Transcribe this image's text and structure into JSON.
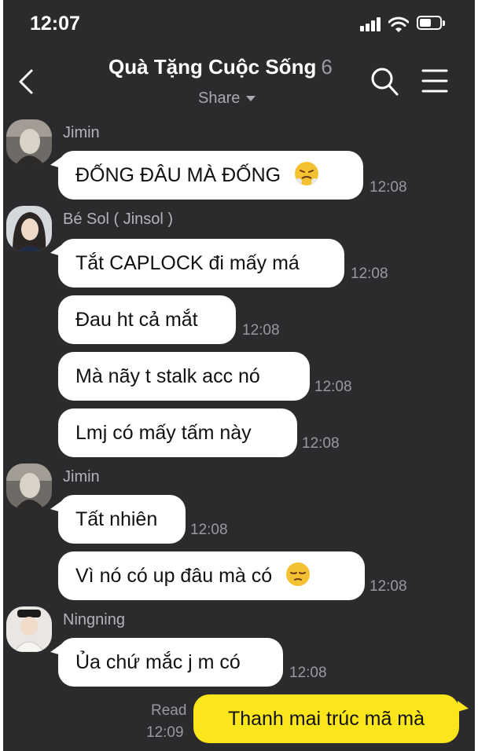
{
  "status_bar": {
    "time": "12:07"
  },
  "header": {
    "title": "Quà Tặng Cuộc Sống",
    "member_count": "6",
    "share_label": "Share"
  },
  "messages": [
    {
      "sender": "Jimin",
      "text": "ĐỐNG ĐÂU MÀ ĐỐNG",
      "emoji": "steam-from-nose-emoji",
      "time": "12:08"
    },
    {
      "sender": "Bé Sol ( Jinsol )",
      "text": "Tắt CAPLOCK đi mấy má",
      "time": "12:08"
    },
    {
      "text": "Đau ht cả mắt",
      "time": "12:08"
    },
    {
      "text": "Mà nãy t stalk acc nó",
      "time": "12:08"
    },
    {
      "text": "Lmj có mấy tấm này",
      "time": "12:08"
    },
    {
      "sender": "Jimin",
      "text": "Tất nhiên",
      "time": "12:08"
    },
    {
      "text": "Vì nó có up đâu mà có",
      "emoji": "pensive-face-emoji",
      "time": "12:08"
    },
    {
      "sender": "Ningning",
      "text": "Ủa chứ mắc j m có",
      "time": "12:08"
    }
  ],
  "own_message": {
    "text": "Thanh mai trúc mã mà",
    "read_label": "Read",
    "time": "12:09"
  },
  "colors": {
    "background": "#2b2b2d",
    "incoming_bubble": "#ffffff",
    "outgoing_bubble": "#fbe51b",
    "meta_text": "#9a9a9e"
  },
  "icons": [
    "back-icon",
    "search-icon",
    "menu-icon",
    "signal-icon",
    "wifi-icon",
    "battery-icon"
  ]
}
